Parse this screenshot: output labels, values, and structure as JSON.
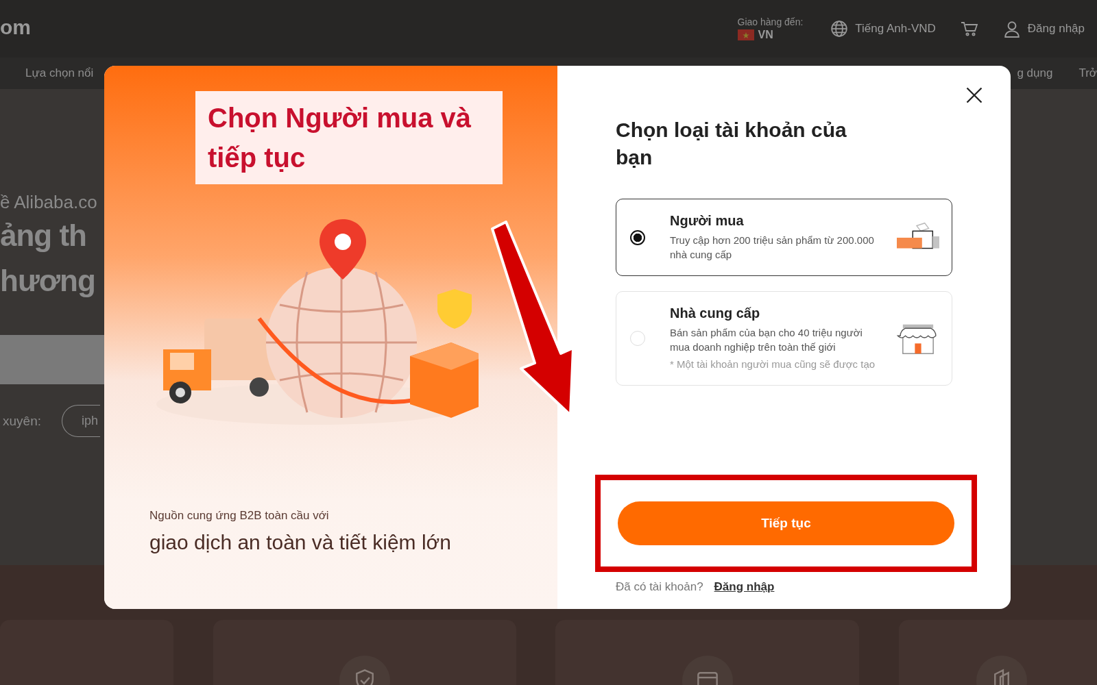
{
  "header": {
    "logo_fragment": "om",
    "delivery_label": "Giao hàng đến:",
    "delivery_country": "VN",
    "language": "Tiếng Anh-VND",
    "login": "Đăng nhập"
  },
  "nav": [
    "Lựa chọn nổi",
    "g dụng",
    "Trở"
  ],
  "hero": {
    "subtitle": "ề Alibaba.co",
    "headline": [
      "ảng th",
      "hương"
    ],
    "frequent_label": "xuyên:",
    "frequent_tags": [
      "iph"
    ]
  },
  "modal": {
    "callout": "Chọn Người mua và tiếp tục",
    "promo": {
      "caption": "Nguồn cung ứng B2B toàn cầu với",
      "headline": "giao dịch an toàn và tiết kiệm lớn"
    },
    "title": "Chọn loại tài khoản của bạn",
    "options": [
      {
        "kind": "buyer",
        "title": "Người mua",
        "description": "Truy cập hơn 200 triệu sản phẩm từ 200.000 nhà cung cấp",
        "selected": true
      },
      {
        "kind": "supplier",
        "title": "Nhà cung cấp",
        "description": "Bán sản phẩm của bạn cho 40 triệu người mua doanh nghiệp trên toàn thế giới",
        "note": "* Một tài khoản người mua cũng sẽ được tạo",
        "selected": false
      }
    ],
    "continue_button": "Tiếp tục",
    "login_prompt": "Đã có tài khoản?",
    "login_link": "Đăng nhập"
  }
}
